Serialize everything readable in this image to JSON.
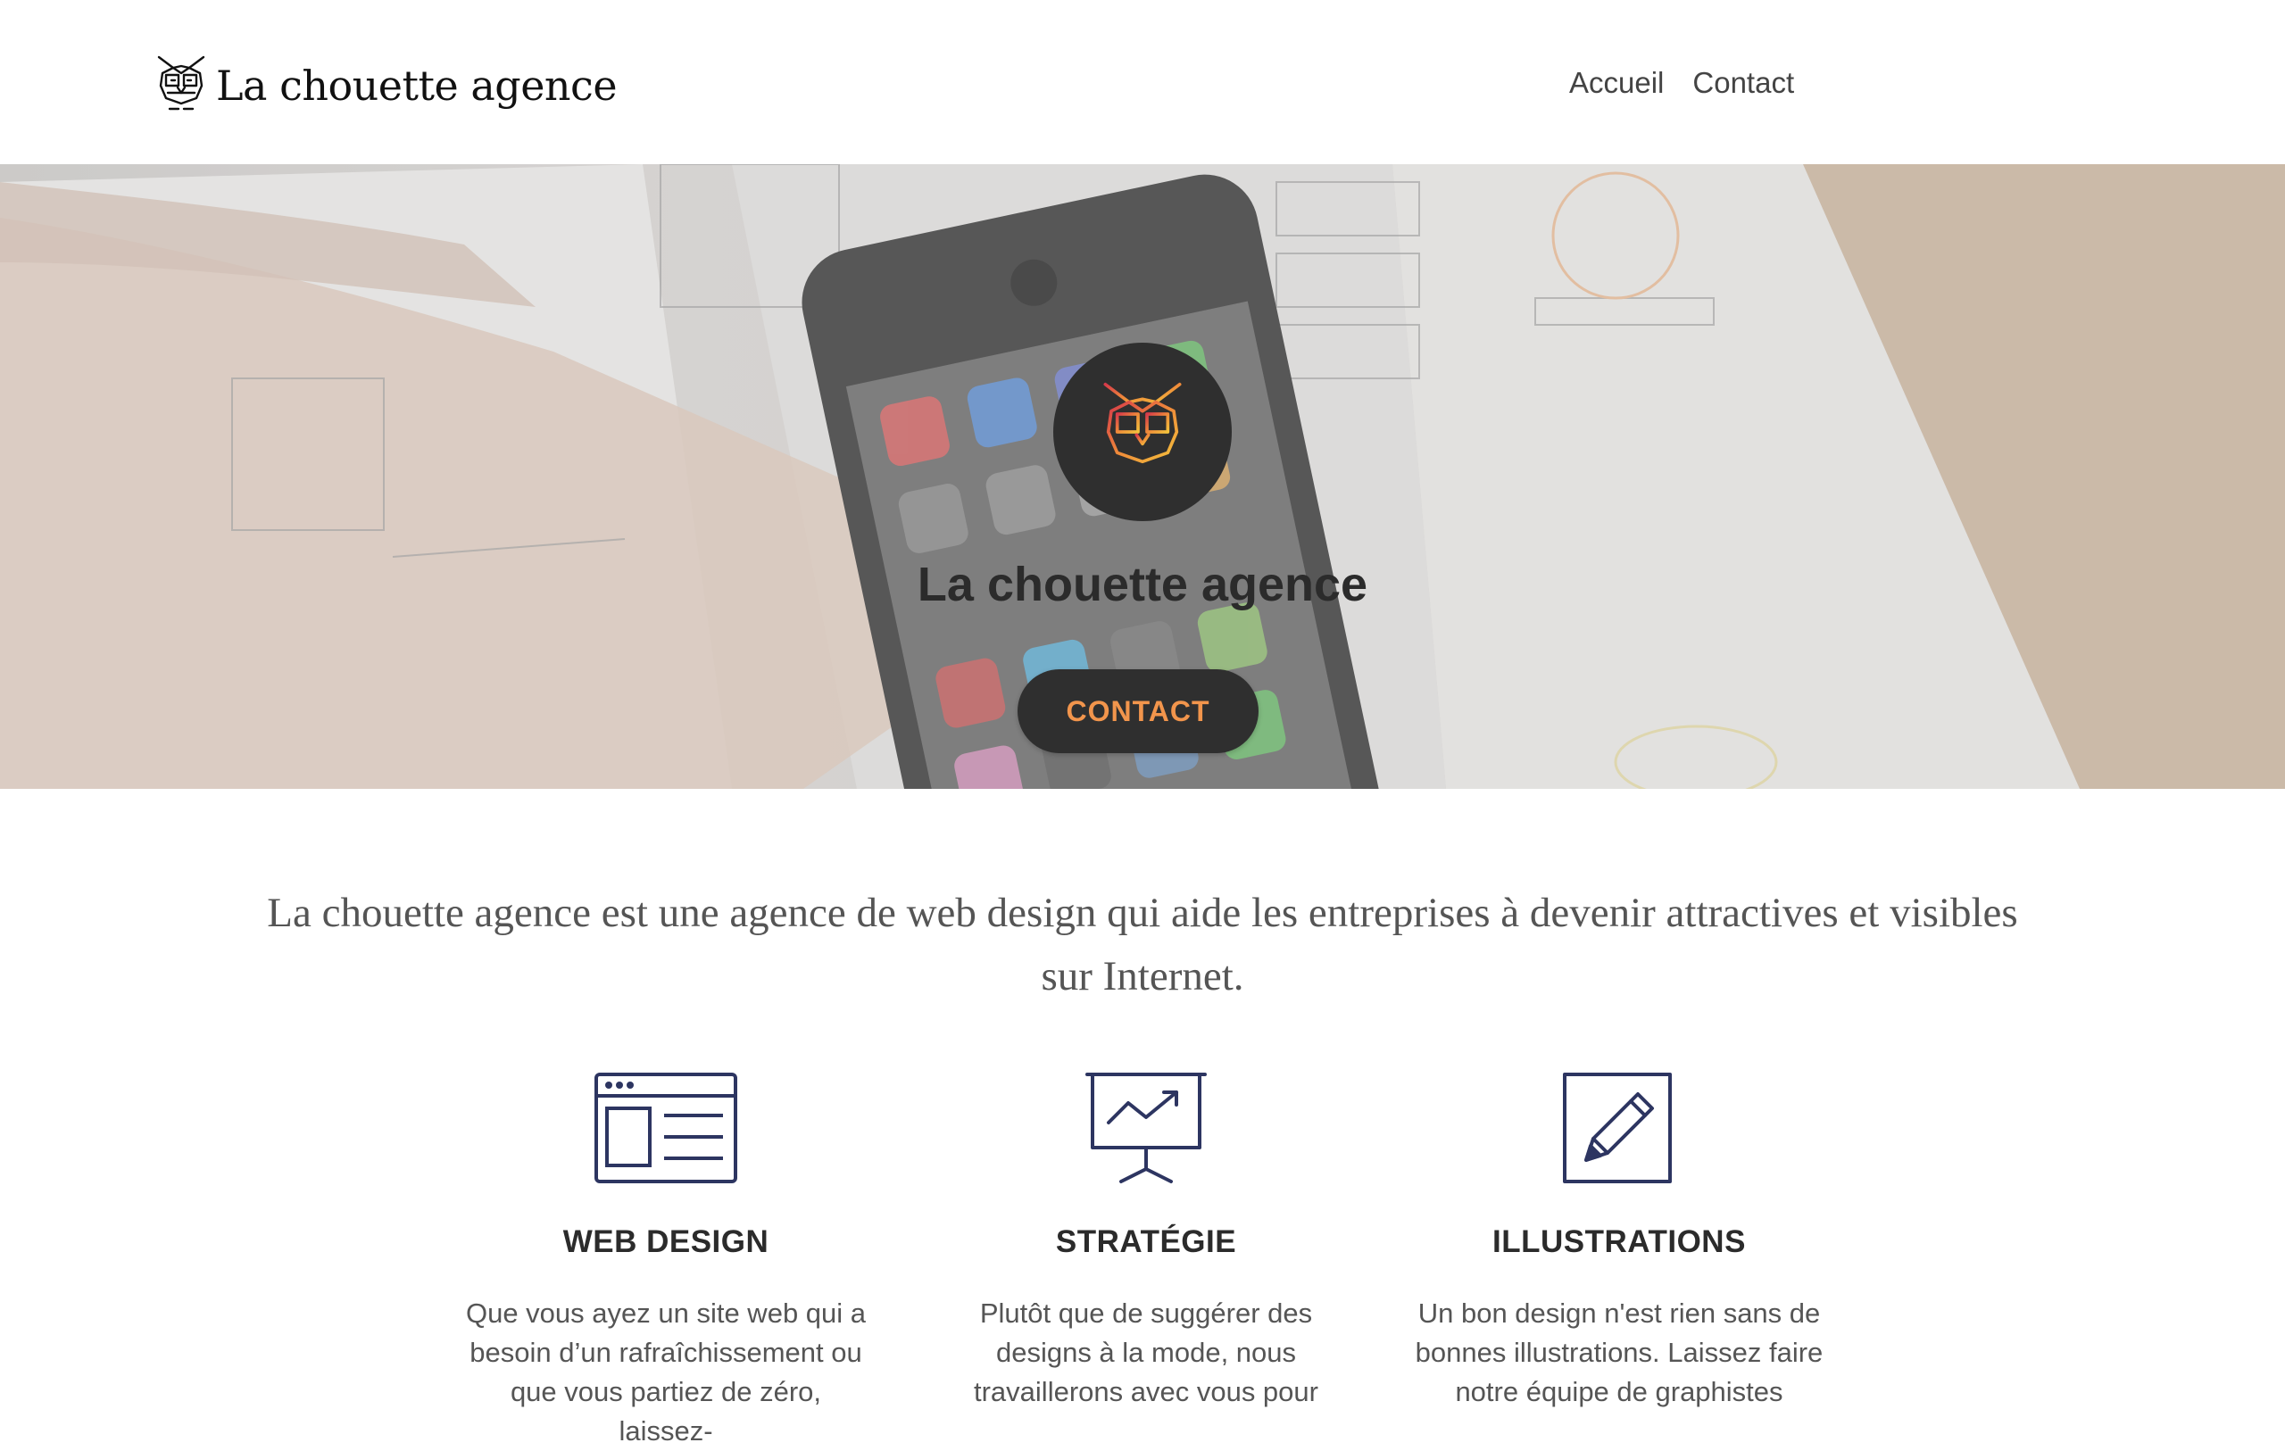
{
  "header": {
    "brand": "La chouette agence",
    "nav": [
      {
        "label": "Accueil"
      },
      {
        "label": "Contact"
      }
    ]
  },
  "hero": {
    "title": "La chouette agence",
    "cta": "CONTACT",
    "background_icon": "phone-wireframes-photo"
  },
  "intro": {
    "text": "La chouette agence est une agence de web design qui aide les entreprises à devenir attractives et visibles sur Internet."
  },
  "services": [
    {
      "icon": "browser-window-icon",
      "title": "WEB DESIGN",
      "description": "Que vous ayez un site web qui a besoin d’un rafraîchissement ou que vous partiez de zéro, laissez-"
    },
    {
      "icon": "presentation-chart-icon",
      "title": "STRATÉGIE",
      "description": "Plutôt que de suggérer des designs à la mode, nous travaillerons avec vous pour"
    },
    {
      "icon": "pencil-icon",
      "title": "ILLUSTRATIONS",
      "description": "Un bon design n'est rien sans de bonnes illustrations. Laissez faire notre équipe de graphistes"
    }
  ],
  "colors": {
    "accent": "#f2954c",
    "dark": "#2f2f2f",
    "icon_navy": "#2d3561"
  }
}
